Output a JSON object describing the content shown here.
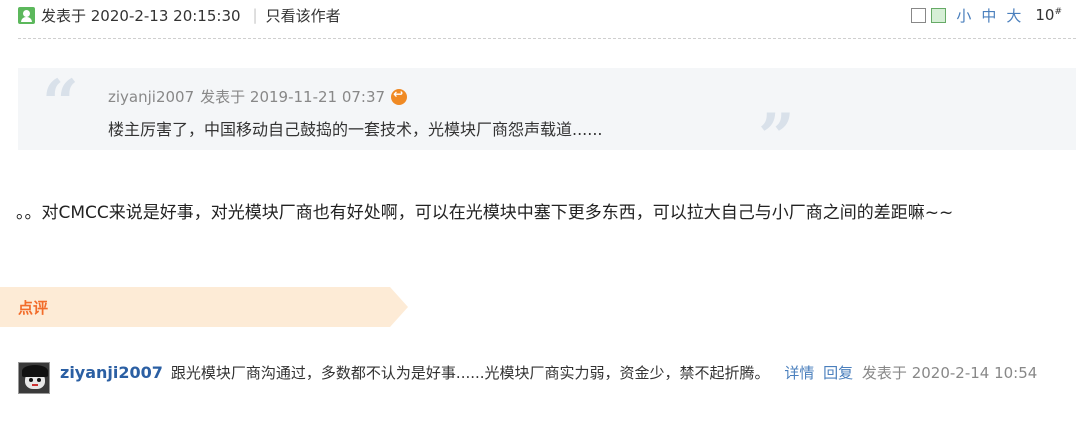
{
  "meta": {
    "post_time": "发表于 2020-2-13 20:15:30",
    "separator": "|",
    "only_author": "只看该作者",
    "font_small": "小",
    "font_medium": "中",
    "font_large": "大",
    "floor_number": "10",
    "floor_suffix": "#"
  },
  "quote": {
    "author": "ziyanji2007",
    "posted_at": "发表于 2019-11-21 07:37",
    "text": "楼主厉害了，中国移动自己鼓捣的一套技术，光模块厂商怨声载道......"
  },
  "post": {
    "body": "。。对CMCC来说是好事，对光模块厂商也有好处啊，可以在光模块中塞下更多东西，可以拉大自己与小厂商之间的差距嘛~~"
  },
  "comments_section": {
    "title": "点评",
    "items": [
      {
        "user": "ziyanji2007",
        "text": "跟光模块厂商沟通过，多数都不认为是好事......光模块厂商实力弱，资金少，禁不起折腾。",
        "detail_link": "详情",
        "reply_link": "回复",
        "time": "发表于 2020-2-14 10:54"
      }
    ]
  },
  "colors": {
    "link": "#4a7fbd",
    "comment_header_bg": "#fdebd6",
    "comment_title": "#f26c2a",
    "quote_bg": "#f4f6f8"
  }
}
